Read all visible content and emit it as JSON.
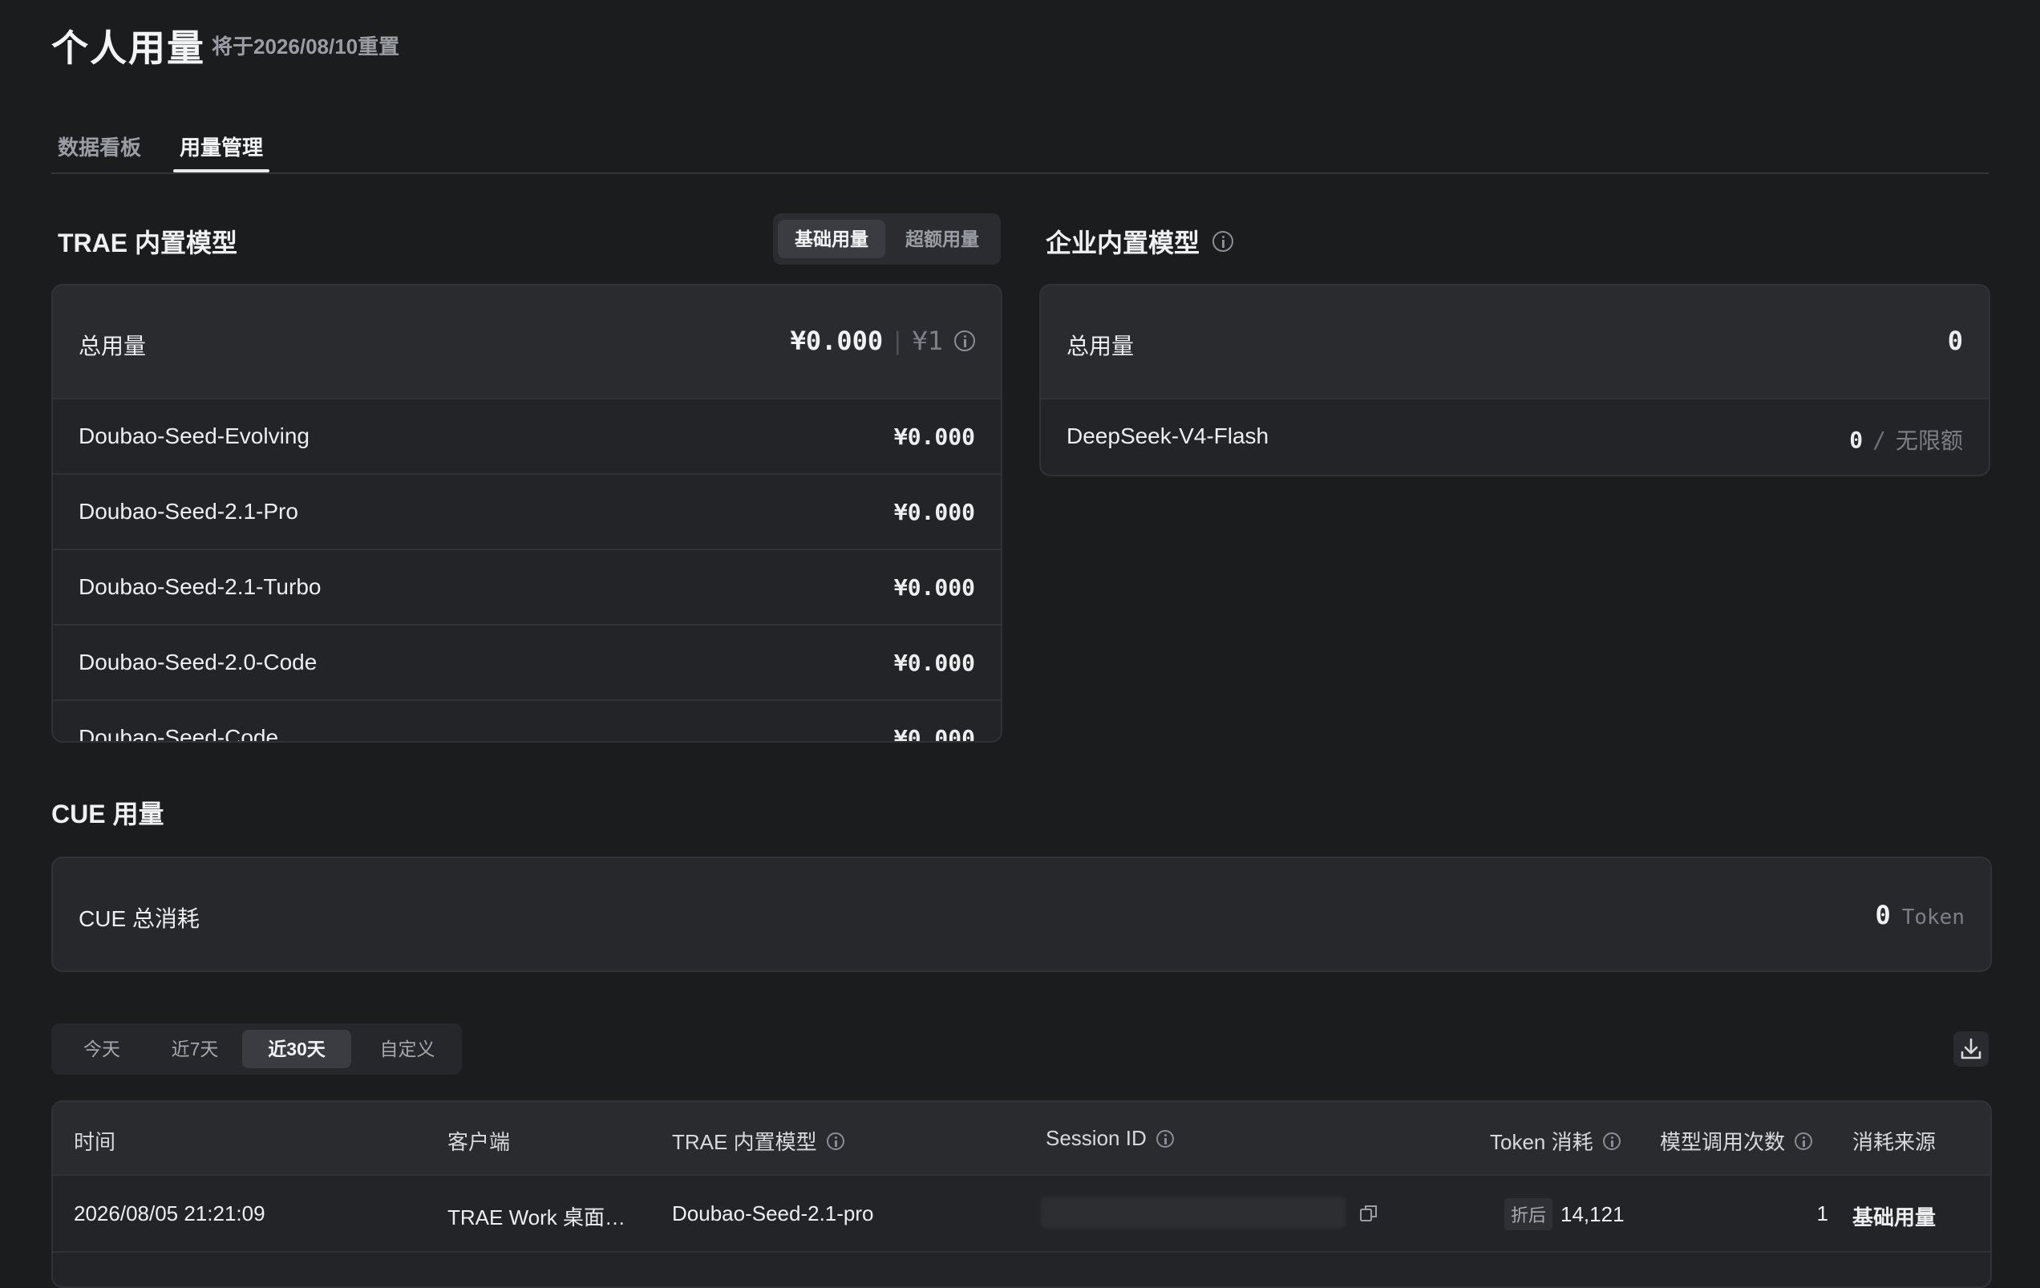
{
  "header": {
    "title": "个人用量",
    "reset_note": "将于2026/08/10重置"
  },
  "tabs": [
    {
      "label": "数据看板",
      "active": false
    },
    {
      "label": "用量管理",
      "active": true
    }
  ],
  "trae_models": {
    "title": "TRAE 内置模型",
    "toggle": {
      "basic_label": "基础用量",
      "over_label": "超额用量",
      "selected": "基础用量"
    },
    "total": {
      "label": "总用量",
      "amount": "¥0.000",
      "separator": "|",
      "limit": "¥1"
    },
    "models": [
      {
        "name": "Doubao-Seed-Evolving",
        "amount": "¥0.000"
      },
      {
        "name": "Doubao-Seed-2.1-Pro",
        "amount": "¥0.000"
      },
      {
        "name": "Doubao-Seed-2.1-Turbo",
        "amount": "¥0.000"
      },
      {
        "name": "Doubao-Seed-2.0-Code",
        "amount": "¥0.000"
      },
      {
        "name": "Doubao-Seed-Code",
        "amount": "¥0.000"
      }
    ]
  },
  "enterprise_models": {
    "title": "企业内置模型",
    "total": {
      "label": "总用量",
      "value": "0"
    },
    "models": [
      {
        "name": "DeepSeek-V4-Flash",
        "value": "0",
        "separator": "/",
        "limit": "无限额"
      }
    ]
  },
  "cue": {
    "title": "CUE 用量",
    "total_label": "CUE 总消耗",
    "total_value": "0",
    "unit": "Token"
  },
  "range_filter": {
    "options": [
      "今天",
      "近7天",
      "近30天",
      "自定义"
    ],
    "selected": "近30天"
  },
  "table": {
    "headers": {
      "time": "时间",
      "client": "客户端",
      "model": "TRAE 内置模型",
      "session": "Session ID",
      "token": "Token 消耗",
      "calls": "模型调用次数",
      "source": "消耗来源"
    },
    "rows": [
      {
        "time": "2026/08/05 21:21:09",
        "client": "TRAE Work 桌面…",
        "model": "Doubao-Seed-2.1-pro",
        "token_badge": "折后",
        "token": "14,121",
        "calls": "1",
        "source": "基础用量"
      }
    ]
  },
  "icons": {
    "info": "info-circle-icon",
    "download": "download-icon",
    "copy": "copy-icon"
  }
}
